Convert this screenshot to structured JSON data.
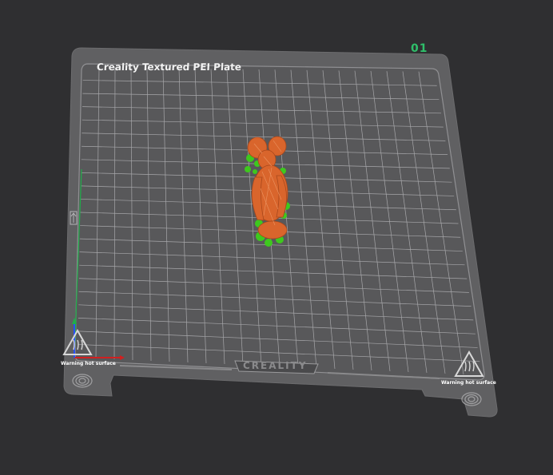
{
  "plate": {
    "number": "01",
    "title": "Creality Textured PEI Plate",
    "brand": "CREALITY",
    "warning_left": "Warning hot surface",
    "warning_right": "Warning hot surface"
  },
  "icons": {
    "axes": "xyz-axes-icon",
    "home": "home-marker-icon",
    "warning": "hot-surface-warning-icon",
    "fingerprint": "fingerprint-icon"
  },
  "colors": {
    "background": "#2f2f31",
    "plate": "#606062",
    "grid": "#b5b5b8",
    "model": "#d9652c",
    "support": "#3ec81e",
    "accent": "#2fbf6a",
    "x_axis": "#d02020",
    "y_axis": "#1fae4a",
    "z_axis": "#2850ff"
  }
}
